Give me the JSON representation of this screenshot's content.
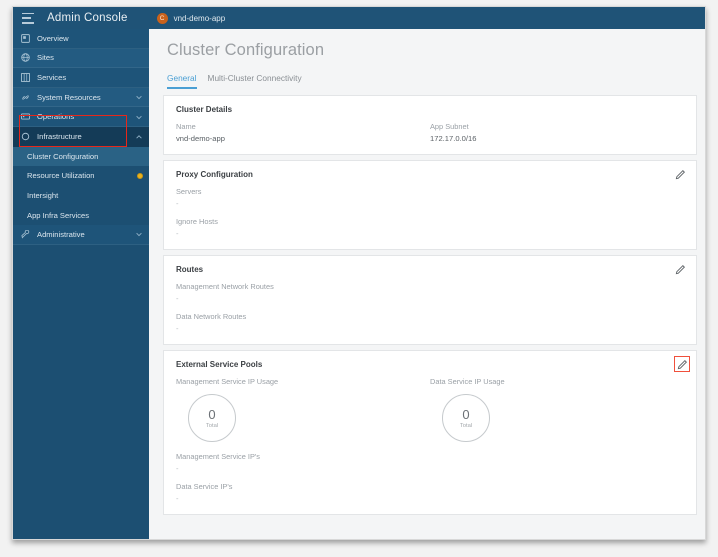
{
  "header": {
    "menu_icon": "hamburger-icon",
    "title": "Admin Console",
    "tenant_avatar_letter": "C",
    "tenant_name": "vnd-demo-app"
  },
  "sidebar": {
    "items": [
      {
        "label": "Overview",
        "icon": "dashboard-icon",
        "chevron": ""
      },
      {
        "label": "Sites",
        "icon": "globe-icon",
        "chevron": ""
      },
      {
        "label": "Services",
        "icon": "grid-icon",
        "chevron": ""
      },
      {
        "label": "System Resources",
        "icon": "link-icon",
        "chevron": "down"
      },
      {
        "label": "Operations",
        "icon": "terminal-icon",
        "chevron": "down"
      },
      {
        "label": "Infrastructure",
        "icon": "circle-icon",
        "chevron": "up"
      },
      {
        "label": "Cluster Configuration",
        "icon": "",
        "chevron": "",
        "child": true,
        "active": true
      },
      {
        "label": "Resource Utilization",
        "icon": "",
        "chevron": "",
        "child": true,
        "badge": "warning-dot-icon"
      },
      {
        "label": "Intersight",
        "icon": "",
        "chevron": "",
        "child": true
      },
      {
        "label": "App Infra Services",
        "icon": "",
        "chevron": "",
        "child": true
      },
      {
        "label": "Administrative",
        "icon": "tools-icon",
        "chevron": "down"
      }
    ],
    "annotation_color": "#e8271a"
  },
  "main": {
    "page_title": "Cluster Configuration",
    "tabs": [
      {
        "label": "General",
        "active": true
      },
      {
        "label": "Multi-Cluster Connectivity",
        "active": false
      }
    ],
    "cards": {
      "cluster_details": {
        "title": "Cluster Details",
        "name_label": "Name",
        "name_value": "vnd-demo-app",
        "subnet_label": "App Subnet",
        "subnet_value": "172.17.0.0/16"
      },
      "proxy_configuration": {
        "title": "Proxy Configuration",
        "edit_icon": "pencil-icon",
        "servers_label": "Servers",
        "servers_value": "-",
        "ignore_hosts_label": "Ignore Hosts",
        "ignore_hosts_value": "-"
      },
      "routes": {
        "title": "Routes",
        "edit_icon": "pencil-icon",
        "mgmt_routes_label": "Management Network Routes",
        "mgmt_routes_value": "-",
        "data_routes_label": "Data Network Routes",
        "data_routes_value": "-"
      },
      "external_service_pools": {
        "title": "External Service Pools",
        "edit_icon": "pencil-icon",
        "edit_annotated": true,
        "annotation_color": "#f0503c",
        "mgmt_usage_label": "Management Service IP Usage",
        "mgmt_usage_value": "0",
        "mgmt_usage_caption": "Total",
        "data_usage_label": "Data Service IP Usage",
        "data_usage_value": "0",
        "data_usage_caption": "Total",
        "mgmt_ips_label": "Management Service IP's",
        "mgmt_ips_value": "-",
        "data_ips_label": "Data Service IP's",
        "data_ips_value": "-"
      }
    }
  }
}
